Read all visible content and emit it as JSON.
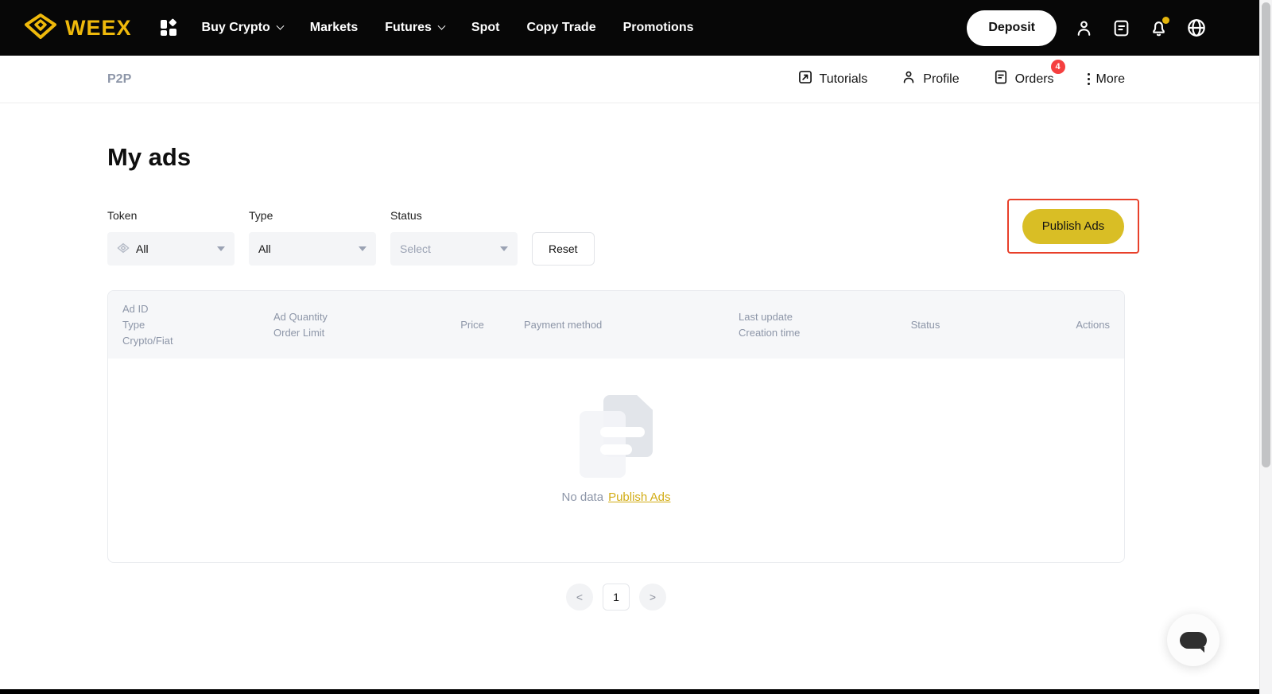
{
  "topnav": {
    "brand": "WEEX",
    "items": [
      {
        "label": "Buy Crypto"
      },
      {
        "label": "Markets"
      },
      {
        "label": "Futures"
      },
      {
        "label": "Spot"
      },
      {
        "label": "Copy Trade"
      },
      {
        "label": "Promotions"
      }
    ],
    "deposit_label": "Deposit"
  },
  "subnav": {
    "breadcrumb": "P2P",
    "tutorials_label": "Tutorials",
    "profile_label": "Profile",
    "orders_label": "Orders",
    "orders_badge": "4",
    "more_label": "More"
  },
  "main": {
    "title": "My ads",
    "filters": {
      "token_label": "Token",
      "token_value": "All",
      "type_label": "Type",
      "type_value": "All",
      "status_label": "Status",
      "status_placeholder": "Select",
      "reset_label": "Reset"
    },
    "publish_button_label": "Publish Ads",
    "table": {
      "col1_line1": "Ad ID",
      "col1_line2": "Type",
      "col1_line3": "Crypto/Fiat",
      "col2_line1": "Ad Quantity",
      "col2_line2": "Order Limit",
      "col3": "Price",
      "col4": "Payment method",
      "col5_line1": "Last update",
      "col5_line2": "Creation time",
      "col6": "Status",
      "col7": "Actions",
      "empty_text": "No data",
      "empty_link": "Publish Ads"
    },
    "pagination": {
      "page": "1"
    }
  },
  "colors": {
    "brand_yellow": "#EFB90B",
    "publish_button_yellow": "#D9BE25",
    "annotation_red": "#E8402A",
    "orders_badge_red": "#F53F3F",
    "empty_link_gold": "#D2AC15",
    "topnav_black": "#070707",
    "muted_gray": "#8D96A8"
  }
}
